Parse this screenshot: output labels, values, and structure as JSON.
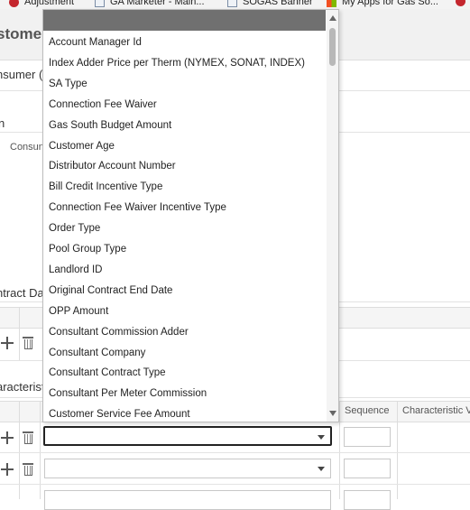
{
  "bookmarks": [
    {
      "label": "Adjustment",
      "icon": "oracle-icon"
    },
    {
      "label": "GA Marketer - Main...",
      "icon": "page-icon"
    },
    {
      "label": "SOGAS Banner",
      "icon": "page-icon"
    },
    {
      "label": "My Apps for Gas So...",
      "icon": "microsoft-icon"
    },
    {
      "label": "",
      "icon": "oracle-icon"
    }
  ],
  "page": {
    "title_partial": "stome",
    "section_consumer": "nsumer (",
    "section_main": "n",
    "consumer_label": "Consun",
    "section_contract": "ntract Da",
    "section_characteristics": "aracterist"
  },
  "characteristics_grid": {
    "columns": [
      "Sequence",
      "Characteristic V"
    ]
  },
  "dropdown": {
    "selected_value": "",
    "items": [
      "Account Manager Id",
      "Index Adder Price per Therm (NYMEX, SONAT, INDEX)",
      "SA Type",
      "Connection Fee Waiver",
      "Gas South Budget Amount",
      "Customer Age",
      "Distributor Account Number",
      "Bill Credit Incentive Type",
      "Connection Fee Waiver Incentive Type",
      "Order Type",
      "Pool Group Type",
      "Landlord ID",
      "Original Contract End Date",
      "OPP Amount",
      "Consultant Commission Adder",
      "Consultant Company",
      "Consultant Contract Type",
      "Consultant Per Meter Commission",
      "Customer Service Fee Amount"
    ]
  }
}
